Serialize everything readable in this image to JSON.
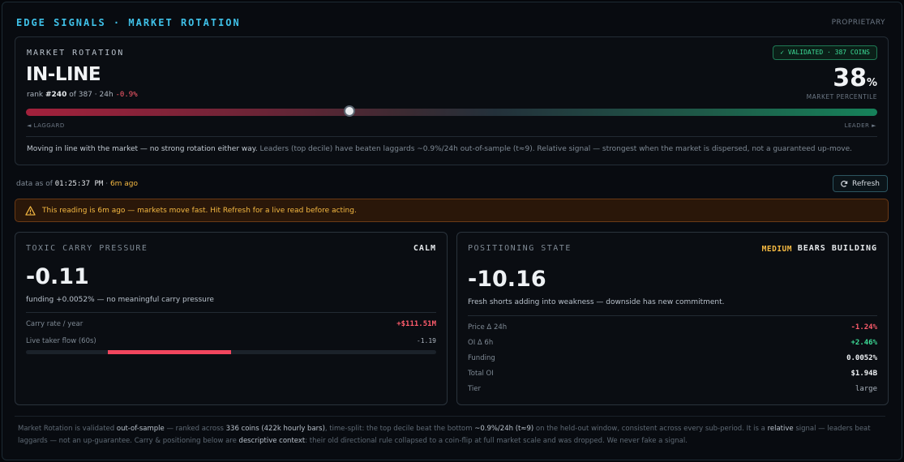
{
  "header": {
    "title": "EDGE SIGNALS · MARKET ROTATION",
    "badge": "PROPRIETARY"
  },
  "rotation": {
    "label": "MARKET ROTATION",
    "validated": "✓ VALIDATED · 387 COINS",
    "state": "IN-LINE",
    "rank_prefix": "rank ",
    "rank": "#240",
    "rank_mid": " of 387 · 24h ",
    "change": "-0.9%",
    "percentile_value": "38",
    "percentile_unit": "%",
    "percentile_label": "MARKET PERCENTILE",
    "percentile_fraction": 0.38,
    "scale_left": "◄ LAGGARD",
    "scale_right": "LEADER ►",
    "desc_lead": "Moving in line with the market — no strong rotation either way.",
    "desc_rest": " Leaders (top decile) have beaten laggards ~0.9%/24h out-of-sample (t≈9). Relative signal — strongest when the market is dispersed, not a guaranteed up-move."
  },
  "asof": {
    "prefix": "data as of ",
    "time": "01:25:37 PM",
    "sep": " · ",
    "ago": "6m ago"
  },
  "refresh": {
    "label": "Refresh",
    "icon": "refresh-icon"
  },
  "warning": {
    "icon": "warning-icon",
    "text": "This reading is 6m ago — markets move fast. Hit Refresh for a live read before acting."
  },
  "carry": {
    "title": "TOXIC CARRY PRESSURE",
    "tag": "CALM",
    "value": "-0.11",
    "sub": "funding +0.0052% — no meaningful carry pressure",
    "rate_label": "Carry rate / year",
    "rate_value": "+$111.51M",
    "flow_label": "Live taker flow (60s)",
    "flow_value": "-1.19",
    "flow_start": 0.2,
    "flow_end": 0.5
  },
  "positioning": {
    "title": "POSITIONING STATE",
    "tag_level": "MEDIUM",
    "tag_state": "BEARS BUILDING",
    "value": "-10.16",
    "sub": "Fresh shorts adding into weakness — downside has new commitment.",
    "rows": [
      {
        "key": "Price Δ 24h",
        "value": "-1.24%"
      },
      {
        "key": "OI Δ 6h",
        "value": "+2.46%"
      },
      {
        "key": "Funding",
        "value": "0.0052%"
      },
      {
        "key": "Total OI",
        "value": "$1.94B"
      },
      {
        "key": "Tier",
        "value": "large"
      }
    ]
  },
  "footer": {
    "t1": "Market Rotation is validated ",
    "h1": "out-of-sample",
    "t2": " — ranked across ",
    "h2": "336 coins (422k hourly bars)",
    "t3": ", time-split: the top decile beat the bottom ",
    "h3": "~0.9%/24h (t≈9)",
    "t4": " on the held-out window, consistent across every sub-period. It is a ",
    "h4": "relative",
    "t5": " signal — leaders beat laggards — not an up-guarantee. Carry & positioning below are ",
    "h5": "descriptive context",
    "t6": ": their old directional rule collapsed to a coin-flip at full market scale and was dropped. We never fake a signal."
  },
  "colors": {
    "accent": "#3fc1e8",
    "positive": "#3ddc97",
    "negative": "#ff5c6c",
    "warning": "#f5b942"
  }
}
